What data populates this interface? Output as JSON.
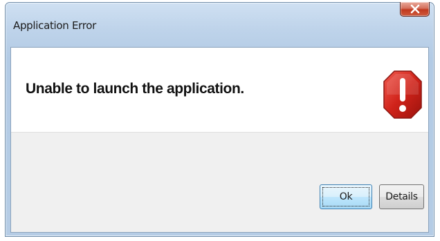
{
  "window": {
    "title": "Application Error",
    "close_label": "X"
  },
  "message": {
    "text": "Unable to launch the application.",
    "icon": "error-stop-icon"
  },
  "buttons": {
    "ok_label": "Ok",
    "details_label": "Details"
  },
  "colors": {
    "close_button": "#c0391f",
    "error_icon": "#d0231a",
    "content_background": "#f0f0f0",
    "message_background": "#ffffff"
  }
}
